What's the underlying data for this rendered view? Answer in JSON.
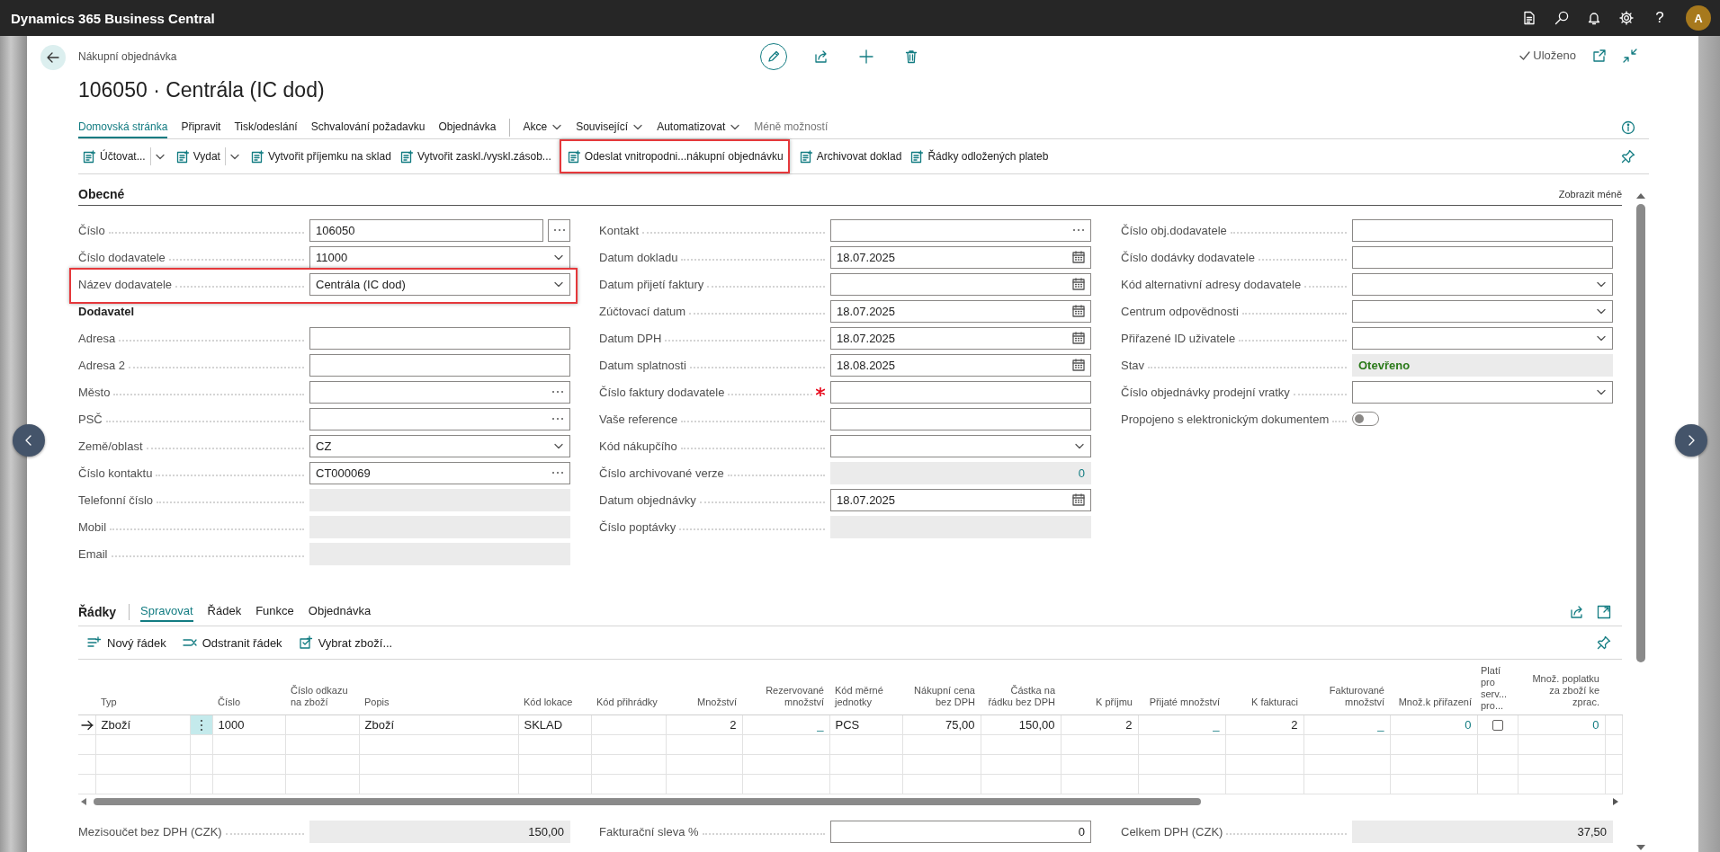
{
  "topbar": {
    "title": "Dynamics 365 Business Central",
    "help": "?",
    "avatar": "A"
  },
  "header": {
    "caption": "Nákupní objednávka",
    "title": "106050 · Centrála (IC dod)",
    "status": "Uloženo"
  },
  "menu": [
    {
      "label": "Domovská stránka",
      "kind": "tab",
      "selected": true
    },
    {
      "label": "Připravit",
      "kind": "tab",
      "selected": false
    },
    {
      "label": "Tisk/odeslání",
      "kind": "tab",
      "selected": false
    },
    {
      "label": "Schvalování požadavku",
      "kind": "tab",
      "selected": false
    },
    {
      "label": "Objednávka",
      "kind": "tab",
      "selected": false
    },
    {
      "label": "Akce",
      "kind": "dropdown",
      "selected": false
    },
    {
      "label": "Související",
      "kind": "dropdown",
      "selected": false
    },
    {
      "label": "Automatizovat",
      "kind": "dropdown",
      "selected": false
    },
    {
      "label": "Méně možností",
      "kind": "more",
      "selected": false
    }
  ],
  "actions": [
    {
      "label": "Účtovat...",
      "kind": "split",
      "highlighted": false
    },
    {
      "label": "Vydat",
      "kind": "split",
      "highlighted": false
    },
    {
      "label": "Vytvořit příjemku na sklad",
      "kind": "button",
      "highlighted": false
    },
    {
      "label": "Vytvořit zaskl./vyskl.zásob...",
      "kind": "button",
      "highlighted": false
    },
    {
      "label": "Odeslat vnitropodni...nákupní objednávku",
      "kind": "button",
      "highlighted": true
    },
    {
      "label": "Archivovat doklad",
      "kind": "button",
      "highlighted": false
    },
    {
      "label": "Řádky odložených plateb",
      "kind": "button",
      "highlighted": false
    }
  ],
  "general": {
    "title": "Obecné",
    "toggle": "Zobrazit méně",
    "columns": [
      {
        "fields": [
          {
            "label": "Číslo",
            "kind": "assist",
            "value": "106050"
          },
          {
            "label": "Číslo dodavatele",
            "kind": "dropdown",
            "value": "11000"
          },
          {
            "label": "Název dodavatele",
            "kind": "dropdown",
            "value": "Centrála (IC dod)",
            "highlighted": true
          },
          {
            "label": "Dodavatel",
            "kind": "heading"
          },
          {
            "label": "Adresa",
            "kind": "text"
          },
          {
            "label": "Adresa 2",
            "kind": "text"
          },
          {
            "label": "Město",
            "kind": "lookup"
          },
          {
            "label": "PSČ",
            "kind": "lookup"
          },
          {
            "label": "Země/oblast",
            "kind": "dropdown",
            "value": "CZ"
          },
          {
            "label": "Číslo kontaktu",
            "kind": "lookup",
            "value": "CT000069"
          },
          {
            "label": "Telefonní číslo",
            "kind": "readonly"
          },
          {
            "label": "Mobil",
            "kind": "readonly"
          },
          {
            "label": "Email",
            "kind": "readonly"
          }
        ]
      },
      {
        "fields": [
          {
            "label": "Kontakt",
            "kind": "lookup"
          },
          {
            "label": "Datum dokladu",
            "kind": "date",
            "value": "18.07.2025"
          },
          {
            "label": "Datum přijetí faktury",
            "kind": "date"
          },
          {
            "label": "Zúčtovací datum",
            "kind": "date",
            "value": "18.07.2025"
          },
          {
            "label": "Datum DPH",
            "kind": "date",
            "value": "18.07.2025"
          },
          {
            "label": "Datum splatnosti",
            "kind": "date",
            "value": "18.08.2025"
          },
          {
            "label": "Číslo faktury dodavatele",
            "kind": "text",
            "required": true
          },
          {
            "label": "Vaše reference",
            "kind": "text"
          },
          {
            "label": "Kód nákupčího",
            "kind": "dropdown"
          },
          {
            "label": "Číslo archivované verze",
            "kind": "readonly_link",
            "value": "0"
          },
          {
            "label": "Datum objednávky",
            "kind": "date",
            "value": "18.07.2025"
          },
          {
            "label": "Číslo poptávky",
            "kind": "readonly"
          }
        ]
      },
      {
        "fields": [
          {
            "label": "Číslo obj.dodavatele",
            "kind": "text"
          },
          {
            "label": "Číslo dodávky dodavatele",
            "kind": "text"
          },
          {
            "label": "Kód alternativní adresy dodavatele",
            "kind": "dropdown"
          },
          {
            "label": "Centrum odpovědnosti",
            "kind": "dropdown"
          },
          {
            "label": "Přiřazené ID uživatele",
            "kind": "dropdown"
          },
          {
            "label": "Stav",
            "kind": "status",
            "value": "Otevřeno"
          },
          {
            "label": "Číslo objednávky prodejní vratky",
            "kind": "dropdown"
          },
          {
            "label": "Propojeno s elektronickým dokumentem",
            "kind": "toggle",
            "on": false
          }
        ]
      }
    ]
  },
  "lines": {
    "title": "Řádky",
    "tabs": [
      {
        "label": "Spravovat",
        "selected": true
      },
      {
        "label": "Řádek",
        "selected": false
      },
      {
        "label": "Funkce",
        "selected": false
      },
      {
        "label": "Objednávka",
        "selected": false
      }
    ],
    "actions": [
      {
        "label": "Nový řádek"
      },
      {
        "label": "Odstranit řádek"
      },
      {
        "label": "Vybrat zboží..."
      }
    ],
    "columns": [
      {
        "label": "Typ",
        "kind": "text"
      },
      {
        "label": "Číslo",
        "kind": "text"
      },
      {
        "label": "Číslo odkazu na zboží",
        "kind": "text"
      },
      {
        "label": "Popis",
        "kind": "text"
      },
      {
        "label": "Kód lokace",
        "kind": "text"
      },
      {
        "label": "Kód přihrádky",
        "kind": "text"
      },
      {
        "label": "Množství",
        "kind": "number"
      },
      {
        "label": "Rezervované množství",
        "kind": "drilldown"
      },
      {
        "label": "Kód měrné jednotky",
        "kind": "text"
      },
      {
        "label": "Nákupní cena bez DPH",
        "kind": "number"
      },
      {
        "label": "Částka na řádku bez DPH",
        "kind": "number"
      },
      {
        "label": "K příjmu",
        "kind": "number"
      },
      {
        "label": "Přijaté množství",
        "kind": "drilldown"
      },
      {
        "label": "K fakturaci",
        "kind": "number"
      },
      {
        "label": "Fakturované množství",
        "kind": "drilldown"
      },
      {
        "label": "Množ.k přiřazení",
        "kind": "drilldown"
      },
      {
        "label": "Platí pro serv... pro...",
        "kind": "checkbox"
      },
      {
        "label": "Množ. poplatku za zboží ke zprac.",
        "kind": "drilldown"
      }
    ],
    "rows": [
      {
        "selected": true,
        "cells": [
          "Zboží",
          "1000",
          null,
          "Zboží",
          "SKLAD",
          null,
          "2",
          "_",
          "PCS",
          "75,00",
          "150,00",
          "2",
          "_",
          "2",
          "_",
          "0",
          {
            "checked": false
          },
          "0"
        ]
      }
    ]
  },
  "totals": {
    "fields": [
      {
        "label": "Mezisoučet bez DPH (CZK)",
        "kind": "readonly_amount",
        "value": "150,00"
      },
      {
        "label": "Fakturační sleva %",
        "kind": "number",
        "value": "0"
      },
      {
        "label": "Celkem DPH (CZK)",
        "kind": "readonly_amount",
        "value": "37,50"
      }
    ]
  }
}
